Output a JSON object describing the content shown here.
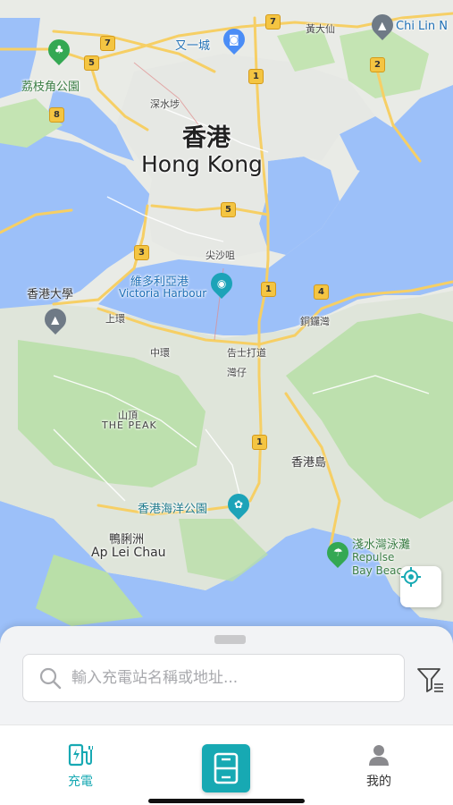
{
  "map": {
    "labels": {
      "city_zh": "香港",
      "city_en": "Hong Kong",
      "lai_chi_kok_park": "荔枝角公園",
      "yat_yi_city": "又一城",
      "wong_tai_sin": "黃大仙",
      "chi_lin": "Chi Lin N",
      "sham_shui_po": "深水埗",
      "tsim_sha_tsui": "尖沙咀",
      "victoria_harbour_zh": "維多利亞港",
      "victoria_harbour_en": "Victoria Harbour",
      "hku": "香港大學",
      "sheung_wan": "上環",
      "central": "中環",
      "wan_chai": "灣仔",
      "gloucester_rd": "告士打道",
      "causeway_bay": "銅鑼灣",
      "the_peak_zh": "山頂",
      "the_peak_en": "THE PEAK",
      "hk_island": "香港島",
      "ocean_park": "香港海洋公園",
      "ap_lei_chau_zh": "鴨脷洲",
      "ap_lei_chau_en": "Ap Lei Chau",
      "repulse_bay_zh": "淺水灣泳灘",
      "repulse_bay_en1": "Repulse",
      "repulse_bay_en2": "Bay Beac"
    },
    "route_shields": [
      "7",
      "5",
      "8",
      "7",
      "1",
      "2",
      "5",
      "3",
      "1",
      "4",
      "1"
    ]
  },
  "search": {
    "placeholder": "輸入充電站名稱或地址..."
  },
  "tabs": {
    "charging": "充電",
    "mine": "我的"
  },
  "colors": {
    "accent": "#17a9b3",
    "water": "#9cc0f9",
    "land": "#e8eae6",
    "park": "#b9dfa8",
    "road": "#f6cf65"
  }
}
